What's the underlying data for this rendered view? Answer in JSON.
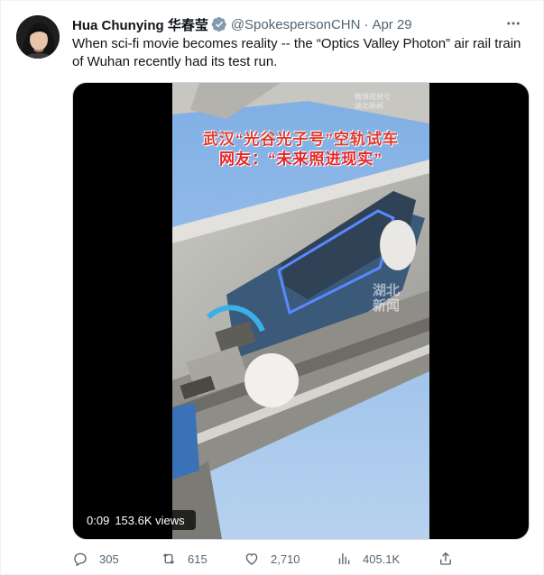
{
  "tweet": {
    "author_name": "Hua Chunying 华春莹",
    "handle": "@SpokespersonCHN",
    "separator": "·",
    "date": "Apr 29",
    "text": "When sci-fi movie becomes reality -- the “Optics Valley Photon” air rail train of Wuhan recently had its test run."
  },
  "media": {
    "overlay_line1": "武汉“光谷光子号”空轨试车",
    "overlay_line2": "网友：“未来照进现实”",
    "watermark_top": "微博视频号",
    "watermark_top_sub": "湖北新闻",
    "watermark_side": "湖北新闻",
    "duration": "0:09",
    "views": "153.6K views"
  },
  "actions": {
    "replies": "305",
    "retweets": "615",
    "likes": "2,710",
    "views": "405.1K"
  },
  "icons": {
    "verified": "verified-badge-icon",
    "more": "more-icon",
    "reply": "reply-icon",
    "retweet": "retweet-icon",
    "like": "heart-icon",
    "views": "views-icon",
    "share": "share-icon"
  },
  "colors": {
    "text_primary": "#0f1419",
    "text_secondary": "#536471",
    "verified": "#829aab",
    "border": "#cfd9de"
  }
}
